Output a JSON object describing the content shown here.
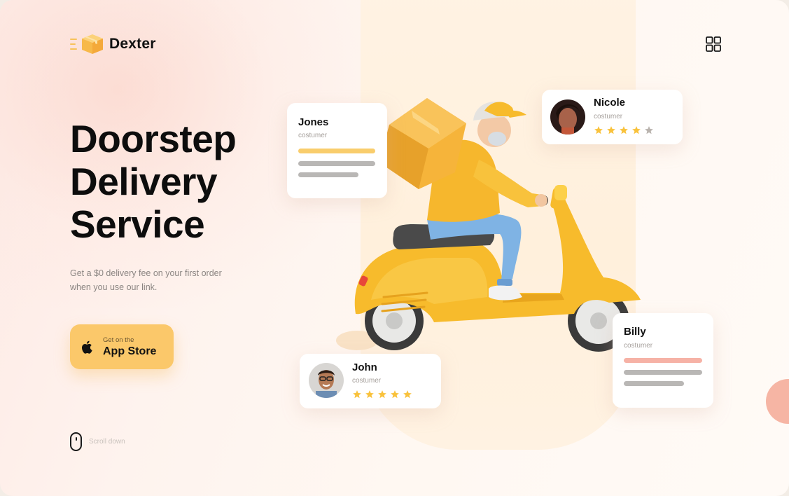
{
  "brand": {
    "name": "Dexter"
  },
  "hero": {
    "headline": [
      "Doorstep",
      "Delivery",
      "Service"
    ],
    "subtitle": "Get a $0 delivery fee on your first order when you use our link.",
    "cta": {
      "small": "Get on the",
      "big": "App Store"
    },
    "scroll_label": "Scroll down"
  },
  "cards": {
    "jones": {
      "name": "Jones",
      "role": "costumer"
    },
    "nicole": {
      "name": "Nicole",
      "role": "costumer",
      "rating": 4,
      "max": 5
    },
    "john": {
      "name": "John",
      "role": "costumer",
      "rating": 5,
      "max": 5
    },
    "billy": {
      "name": "Billy",
      "role": "costumer"
    }
  },
  "colors": {
    "accent": "#fbc86a",
    "star": "#f9c23c",
    "star_empty": "#b9b3ae",
    "bar_yellow": "#f9cd6c",
    "bar_pink": "#f6b2a6",
    "bar_gray": "#b9b7b5"
  },
  "icons": {
    "menu": "grid-icon",
    "cta": "apple-icon",
    "scroll": "mouse-icon",
    "logo": "box-icon"
  }
}
